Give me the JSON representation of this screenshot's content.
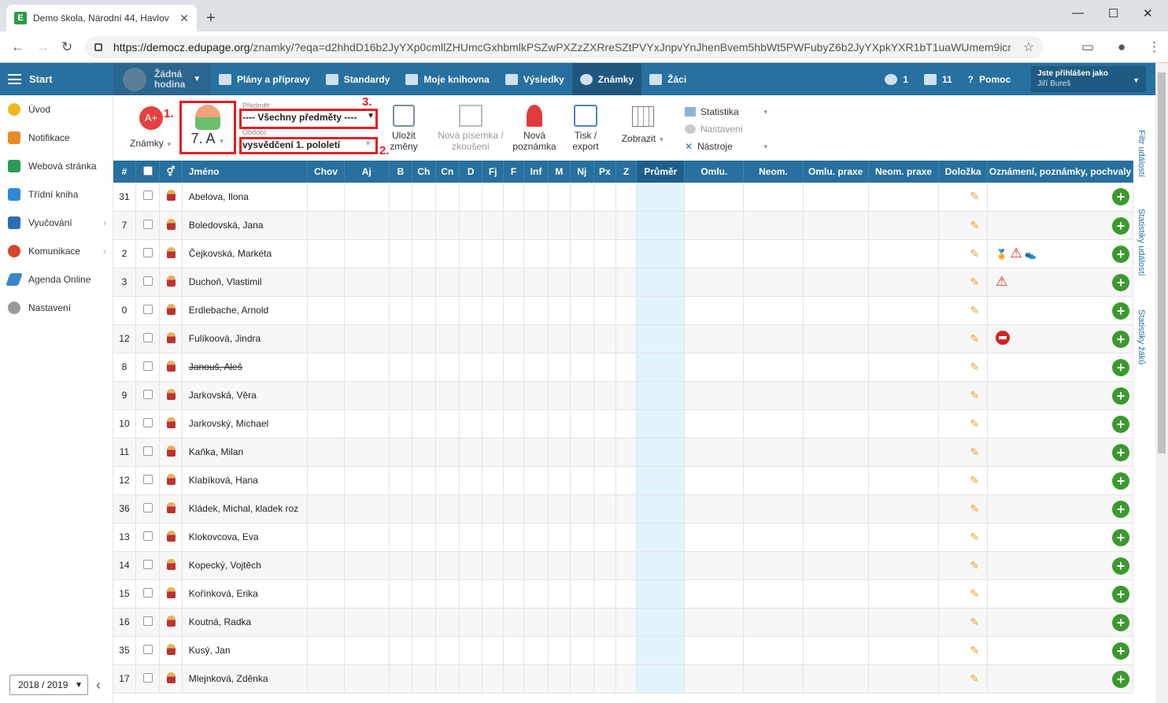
{
  "browser": {
    "tab_title": "Demo škola, Národní 44, Havlov",
    "url_host": "https://democz.edupage.org",
    "url_path": "/znamky/?eqa=d2hhdD16b2JyYXp0cmllZHUmcGxhbmlkPSZwPXZzZXRreSZtPVYxJnpvYnJhenBvem5hbWt5PWFubyZ6b2JyYXpkYXR1bT1uaWUmem9icmF6c..."
  },
  "appbar": {
    "start": "Start",
    "lesson_line1": "Žádná",
    "lesson_line2": "hodina",
    "menu": [
      "Plány a přípravy",
      "Standardy",
      "Moje knihovna",
      "Výsledky",
      "Známky",
      "Žáci"
    ],
    "messages_count": "1",
    "mail_count": "11",
    "help": "Pomoc",
    "user_label": "Jste přihlášen jako",
    "user_name": "Jiří Bureš"
  },
  "sidebar": {
    "items": [
      "Úvod",
      "Notifikace",
      "Webová stránka",
      "Třídní kniha",
      "Vyučování",
      "Komunikace",
      "Agenda Online",
      "Nastavení"
    ],
    "year": "2018 / 2019"
  },
  "toolbar": {
    "grades_label": "Známky",
    "class_label": "7. A",
    "subject_caption": "Předmět:",
    "subject_value": "---- Všechny předměty ----",
    "period_caption": "Období:",
    "period_value": "vysvědčení 1. pololetí",
    "save": "Uložit změny",
    "new_test": "Nová písemka / zkoušení",
    "new_note": "Nová poznámka",
    "print": "Tisk / export",
    "show": "Zobrazit",
    "statistics": "Statistika",
    "settings": "Nastavení",
    "tools": "Nástroje",
    "marker1": "1.",
    "marker2": "2.",
    "marker3": "3."
  },
  "right_tabs": [
    "Filtr událostí",
    "Statistiky událostí",
    "Statistiky žáků"
  ],
  "table": {
    "headers": [
      "#",
      "",
      "",
      "Jméno",
      "Chov",
      "Aj",
      "B",
      "Ch",
      "Cn",
      "D",
      "Fj",
      "F",
      "Inf",
      "M",
      "Nj",
      "Px",
      "Z",
      "Průměr",
      "Omlu.",
      "Neom.",
      "Omlu. praxe",
      "Neom. praxe",
      "Doložka",
      "Oznámení, poznámky, pochvaly"
    ],
    "rows": [
      {
        "num": "31",
        "name": "Abelova, Ilona"
      },
      {
        "num": "7",
        "name": "Boledovská, Jana"
      },
      {
        "num": "2",
        "name": "Čejkovská, Markéta"
      },
      {
        "num": "3",
        "name": "Duchoň, Vlastimil"
      },
      {
        "num": "0",
        "name": "Erdlebache, Arnold"
      },
      {
        "num": "12",
        "name": "Fulíkoová, Jindra"
      },
      {
        "num": "8",
        "name": "Janouš, Aleš"
      },
      {
        "num": "9",
        "name": "Jarkovská, Věra"
      },
      {
        "num": "10",
        "name": "Jarkovský, Michael"
      },
      {
        "num": "11",
        "name": "Kaňka, Milan"
      },
      {
        "num": "12",
        "name": "Klabíková, Hana"
      },
      {
        "num": "36",
        "name": "Kládek, Michal, kladek roz"
      },
      {
        "num": "13",
        "name": "Klokovcova, Eva"
      },
      {
        "num": "14",
        "name": "Kopecký, Vojtěch"
      },
      {
        "num": "15",
        "name": "Kořínková, Erika"
      },
      {
        "num": "16",
        "name": "Koutná, Radka"
      },
      {
        "num": "35",
        "name": "Kusý, Jan"
      },
      {
        "num": "17",
        "name": "Mlejnková, Zděnka"
      }
    ]
  }
}
